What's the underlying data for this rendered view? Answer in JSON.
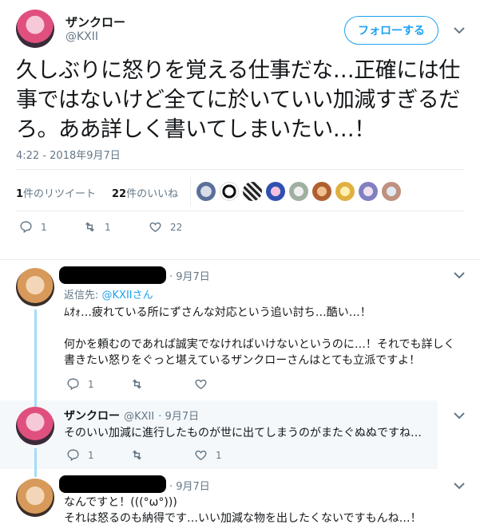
{
  "main_tweet": {
    "name": "ザンクロー",
    "handle": "@KXII",
    "follow_label": "フォローする",
    "text": "久しぶりに怒りを覚える仕事だな…正確には仕事ではないけど全てに於いていい加減すぎるだろ。ああ詳しく書いてしまいたい…！",
    "timestamp": "4:22 - 2018年9月7日",
    "retweets_count": "1",
    "retweets_label": "件のリツイート",
    "likes_count": "22",
    "likes_label": "件のいいね",
    "actions": {
      "reply": "1",
      "retweet": "1",
      "like": "22"
    }
  },
  "replies": [
    {
      "date": "· 9月7日",
      "reply_to_prefix": "返信先: ",
      "reply_to_handle": "@KXIIさん",
      "line1": "ﾑｵｫ…疲れている所にずさんな対応という追い討ち…酷い…！",
      "line2": "何かを頼むのであれば誠実でなければいけないというのに…！それでも詳しく",
      "line3": "書きたい怒りをぐっと堪えているザンクローさんはとても立派ですよ！",
      "actions": {
        "reply": "1",
        "retweet": "",
        "like": ""
      }
    },
    {
      "name": "ザンクロー",
      "handle": "@KXII",
      "date": "· 9月7日",
      "text": "そのいい加減に進行したものが世に出てしまうのがまたぐぬぬですね…",
      "actions": {
        "reply": "1",
        "retweet": "",
        "like": "1"
      }
    },
    {
      "date": "· 9月7日",
      "line1": "なんですと！(((°ω°)))",
      "line2": "それは怒るのも納得です…いい加減な物を出したくないですもんね…！"
    }
  ],
  "icons": [
    "chevron-down-icon",
    "reply-icon",
    "retweet-icon",
    "heart-icon"
  ],
  "colors": {
    "accent": "#1da1f2",
    "muted": "#657786",
    "thread": "#a3dcf8"
  }
}
